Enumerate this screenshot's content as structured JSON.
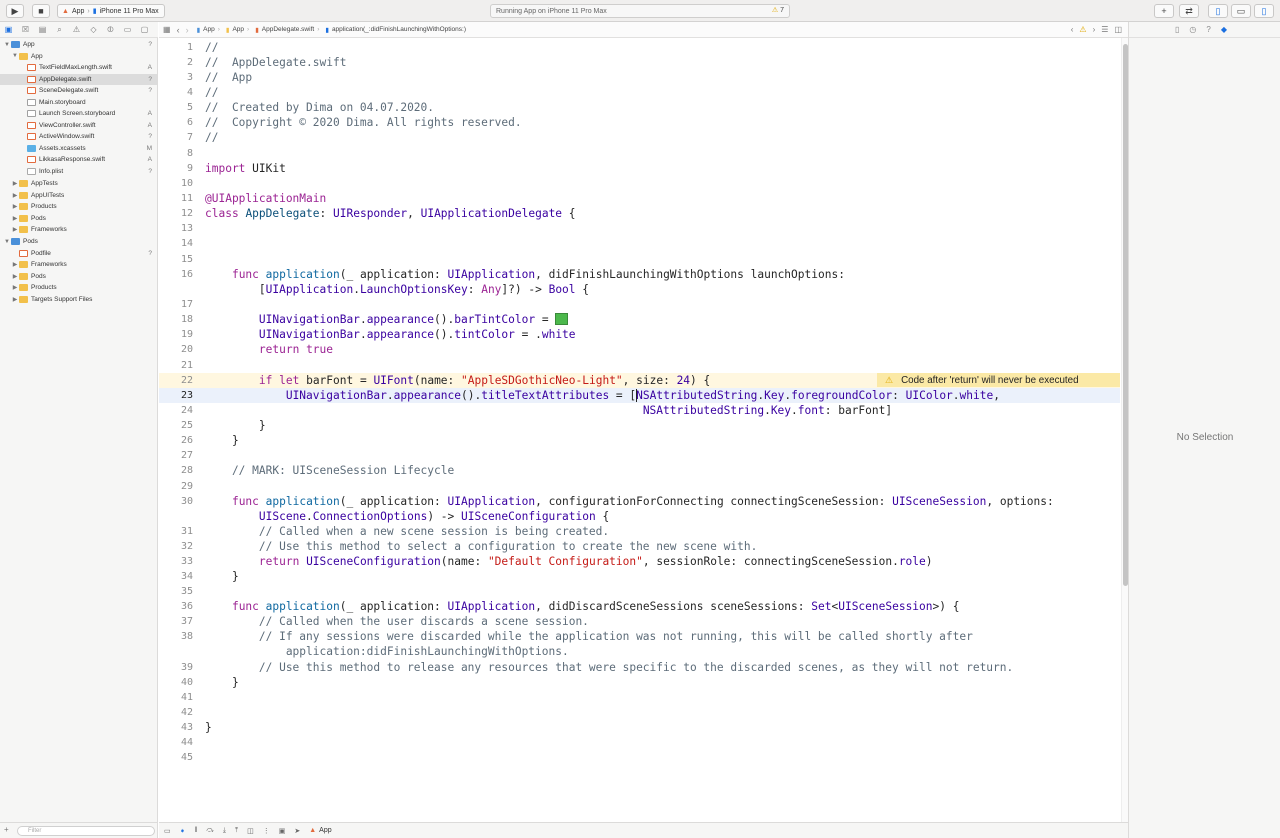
{
  "toolbar": {
    "scheme_app": "App",
    "scheme_device": "iPhone 11 Pro Max",
    "activity": "Running App on iPhone 11 Pro Max",
    "warning_count": "7"
  },
  "navigator": {
    "filter_placeholder": "Filter",
    "items": [
      {
        "label": "App",
        "status": "?"
      },
      {
        "label": "App",
        "status": ""
      },
      {
        "label": "TextFieldMaxLength.swift",
        "status": "A"
      },
      {
        "label": "AppDelegate.swift",
        "status": "?"
      },
      {
        "label": "SceneDelegate.swift",
        "status": "?"
      },
      {
        "label": "Main.storyboard",
        "status": ""
      },
      {
        "label": "Launch Screen.storyboard",
        "status": "A"
      },
      {
        "label": "ViewController.swift",
        "status": "A"
      },
      {
        "label": "ActiveWindow.swift",
        "status": "?"
      },
      {
        "label": "Assets.xcassets",
        "status": "M"
      },
      {
        "label": "LikkasaResponse.swift",
        "status": "A"
      },
      {
        "label": "Info.plist",
        "status": "?"
      },
      {
        "label": "AppTests",
        "status": ""
      },
      {
        "label": "AppUITests",
        "status": ""
      },
      {
        "label": "Products",
        "status": ""
      },
      {
        "label": "Pods",
        "status": ""
      },
      {
        "label": "Frameworks",
        "status": ""
      },
      {
        "label": "Pods",
        "status": ""
      },
      {
        "label": "Podfile",
        "status": "?"
      },
      {
        "label": "Frameworks",
        "status": ""
      },
      {
        "label": "Pods",
        "status": ""
      },
      {
        "label": "Products",
        "status": ""
      },
      {
        "label": "Targets Support Files",
        "status": ""
      }
    ]
  },
  "jumpbar": {
    "crumbs": [
      "App",
      "App",
      "AppDelegate.swift",
      "application(_:didFinishLaunchingWithOptions:)"
    ]
  },
  "editor": {
    "line_numbers": [
      "1",
      "2",
      "3",
      "4",
      "5",
      "6",
      "7",
      "8",
      "9",
      "10",
      "11",
      "12",
      "13",
      "14",
      "15",
      "16",
      "",
      "17",
      "18",
      "19",
      "20",
      "21",
      "22",
      "23",
      "24",
      "25",
      "26",
      "27",
      "28",
      "29",
      "30",
      "",
      "31",
      "32",
      "33",
      "34",
      "35",
      "36",
      "37",
      "38",
      "",
      "39",
      "40",
      "41",
      "42",
      "43",
      "44",
      "45"
    ],
    "warning_message": "Code after 'return' will never be executed",
    "current_line": "23"
  },
  "inspector": {
    "no_selection": "No Selection"
  },
  "debugbar": {
    "target": "App"
  },
  "colors": {
    "accent": "#1b6fe0",
    "keyword": "#9b2393",
    "string": "#c41a16",
    "comment": "#5d6c79",
    "warning_bg": "#fbe9a6",
    "bar_tint_swatch": "#4cb84c"
  }
}
